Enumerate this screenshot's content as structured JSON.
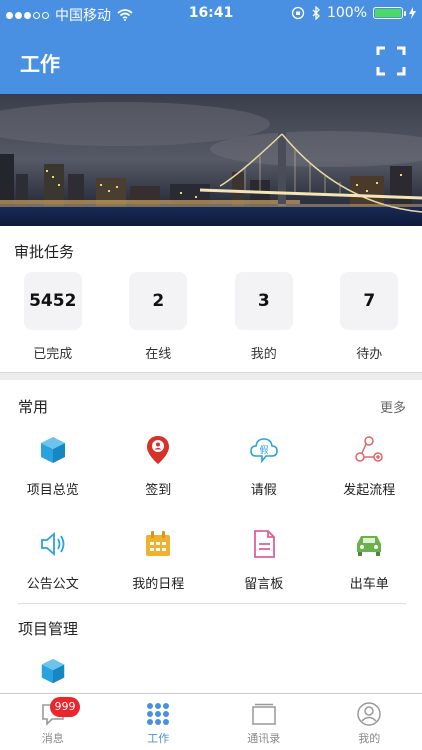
{
  "status_bar": {
    "carrier": "中国移动",
    "time": "16:41",
    "battery": "100%",
    "battery_level": 1.0
  },
  "navbar": {
    "title": "工作",
    "scan_icon": "scan-icon"
  },
  "approval": {
    "title": "审批任务",
    "stats": [
      {
        "value": "5452",
        "label": "已完成"
      },
      {
        "value": "2",
        "label": "在线"
      },
      {
        "value": "3",
        "label": "我的"
      },
      {
        "value": "7",
        "label": "待办"
      }
    ]
  },
  "common": {
    "title": "常用",
    "more": "更多",
    "items": [
      {
        "label": "项目总览",
        "icon": "cube-icon",
        "color": "#2aa2df"
      },
      {
        "label": "签到",
        "icon": "location-pin-icon",
        "color": "#d6322a"
      },
      {
        "label": "请假",
        "icon": "leave-icon",
        "color": "#2aa2df"
      },
      {
        "label": "发起流程",
        "icon": "flow-icon",
        "color": "#e06666"
      },
      {
        "label": "公告公文",
        "icon": "speaker-icon",
        "color": "#2aa2df"
      },
      {
        "label": "我的日程",
        "icon": "calendar-icon",
        "color": "#f0b030"
      },
      {
        "label": "留言板",
        "icon": "document-icon",
        "color": "#e0609a"
      },
      {
        "label": "出车单",
        "icon": "car-icon",
        "color": "#6ab04c"
      }
    ]
  },
  "project": {
    "title": "项目管理",
    "icon": "cube-icon"
  },
  "tabs": [
    {
      "label": "消息",
      "icon": "message-icon",
      "badge": "999"
    },
    {
      "label": "工作",
      "icon": "grid-icon"
    },
    {
      "label": "通讯录",
      "icon": "contacts-icon"
    },
    {
      "label": "我的",
      "icon": "profile-icon"
    }
  ],
  "colors": {
    "primary": "#4a90e2",
    "badge": "#e8262c",
    "battery": "#4cd964"
  }
}
